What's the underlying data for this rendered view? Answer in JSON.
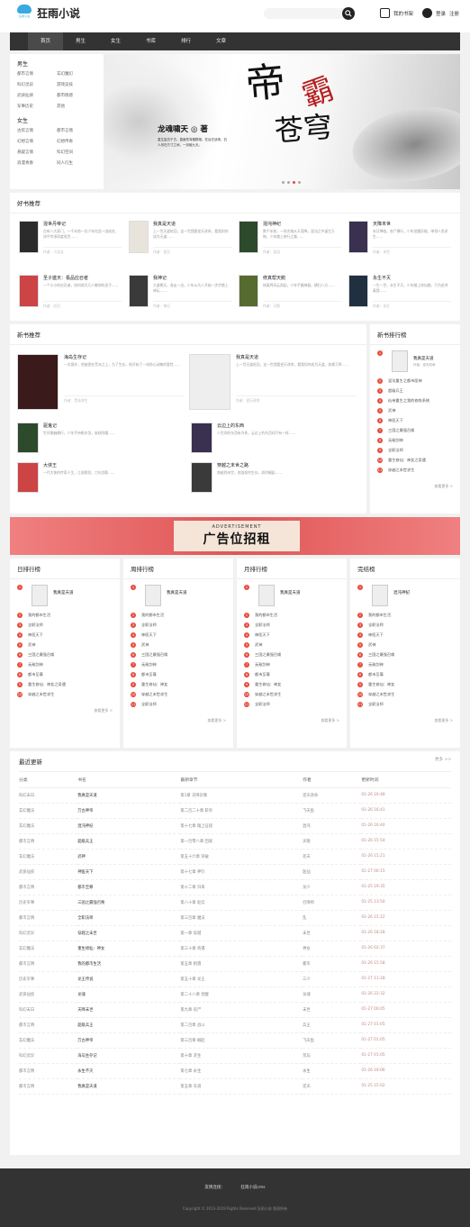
{
  "header": {
    "logo_text": "狂雨小说",
    "logo_tag": "狂雨小说",
    "search_placeholder": "",
    "my_shelf": "我的书架",
    "login": "登录",
    "register": "注册"
  },
  "nav": [
    "首页",
    "男生",
    "女生",
    "书库",
    "排行",
    "文章"
  ],
  "categories": {
    "male_title": "男生",
    "male": [
      "都市言情",
      "玄幻魔幻",
      "科幻灵异",
      "游戏竞技",
      "武侠仙侠",
      "都市情感",
      "军事历史",
      "其他"
    ],
    "female_title": "女生",
    "female": [
      "古装言情",
      "都市言情",
      "幻想言情",
      "幻想传奇",
      "悬疑言情",
      "科幻空间",
      "浪漫青春",
      "同人衍生"
    ]
  },
  "banner": {
    "author": "龙魂啸天 ◎ 著",
    "title_a": "帝",
    "title_b": "霸",
    "title_c": "苍穹",
    "desc": "重生复仇千古，直面苍穹傲群雄，在远古战场，仇人尽在方寸之间，一剑破九天。"
  },
  "good_books": {
    "title": "好书推荐",
    "items": [
      {
        "name": "混世丹帝记",
        "desc": "古有八大豪门，一千年前一位少年在此一战成名，如今传承再度现世……",
        "auth": "作者：小巫女"
      },
      {
        "name": "我真是天道",
        "desc": "上一世天道轮回，这一世我要逆天改命，看我如何成为天道……",
        "auth": "作者：逆天"
      },
      {
        "name": "混沌神纪",
        "desc": "数千年前，一场灾难从天而降，混沌之中诞生万物，少年踏上修行之路……",
        "auth": "作者：混沌"
      },
      {
        "name": "天降末世",
        "desc": "末日降临，丧尸横行，少年觉醒异能，带领人类求生……",
        "auth": "作者：末世"
      },
      {
        "name": "圣子盛天：极品应召者",
        "desc": "一个小小的应召者，如何成为万人敬仰的圣子……",
        "auth": "作者：应召"
      },
      {
        "name": "我神记",
        "desc": "大道朝天，各走一边，少年从凡人开始一步步踏上神坛……",
        "auth": "作者：神记"
      },
      {
        "name": "修真帮天鹅",
        "desc": "修真界风云再起，少年手握神器，横扫八方……",
        "auth": "作者：天鹅"
      },
      {
        "name": "永生不灭",
        "desc": "一生一世，永生不灭，少年踏上修仙路，只为追寻真我……",
        "auth": "作者：永生"
      }
    ]
  },
  "new_books": {
    "title": "新书推荐",
    "big": [
      {
        "name": "海岛生存记",
        "desc": "一次意外，他被困在荒岛之上，为了生存，他开始了一场惊心动魄的冒险……",
        "auth": "作者：荒岛求生"
      },
      {
        "name": "我真是天道",
        "desc": "上一世天道轮回，这一世我要逆天改命，看我如何成为天道，执掌万界……",
        "auth": "作者：逆天改命"
      }
    ],
    "small": [
      {
        "name": "驱鬼记",
        "desc": "世间鬼魅横行，少年手持桃木剑，斩妖除魔……"
      },
      {
        "name": "云边上的东西",
        "desc": "人世间的东西有许多，云边上的东西却只有一样……"
      },
      {
        "name": "大侠王",
        "desc": "一代大侠的传奇人生，江湖恩怨，刀光剑影……"
      },
      {
        "name": "穿越之末世之路",
        "desc": "穿越到末世，他该如何生存，如何崛起……"
      }
    ]
  },
  "new_rank": {
    "title": "新书排行榜",
    "first": {
      "name": "我真是天道",
      "auth": "作者：逆天改命"
    },
    "items": [
      "混沌重生之都市医神",
      "超级兵王",
      "仙帝重生之我的修炼系统",
      "武神",
      "神医天下",
      "三国之最强召唤",
      "无敌剑神",
      "全职法师",
      "重生修仙：神女之奇遇",
      "穿越之末世求生"
    ],
    "more": "查看更多 >"
  },
  "ad": {
    "en": "ADVERTISEMENT",
    "cn": "广告位招租"
  },
  "ranks": [
    {
      "title": "日排行榜",
      "first": "我真是天道",
      "items": [
        "我的都市生活",
        "全职法师",
        "神医天下",
        "武神",
        "三国之最强召唤",
        "无敌剑神",
        "都市至尊",
        "重生修仙：神女之奇遇",
        "穿越之末世求生"
      ],
      "more": "查看更多 >"
    },
    {
      "title": "周排行榜",
      "first": "我真是天道",
      "items": [
        "我的都市生活",
        "全职法师",
        "神医天下",
        "武神",
        "三国之最强召唤",
        "无敌剑神",
        "都市至尊",
        "重生修仙：神女",
        "穿越之末世求生",
        "全职法师"
      ],
      "more": "查看更多 >"
    },
    {
      "title": "月排行榜",
      "first": "我真是天道",
      "items": [
        "我的都市生活",
        "全职法师",
        "神医天下",
        "武神",
        "三国之最强召唤",
        "无敌剑神",
        "都市至尊",
        "重生修仙：神女",
        "穿越之末世求生",
        "全职法师"
      ],
      "more": "查看更多 >"
    },
    {
      "title": "完结榜",
      "first": "混沌神纪",
      "items": [
        "我的都市生活",
        "全职法师",
        "神医天下",
        "武神",
        "三国之最强召唤",
        "无敌剑神",
        "都市至尊",
        "重生修仙：神女",
        "穿越之末世求生",
        "全职法师"
      ],
      "more": "查看更多 >"
    }
  ],
  "latest": {
    "title": "最近更新",
    "more": "更多 >>",
    "cols": [
      "分类",
      "书名",
      "最新章节",
      "作者",
      "更新时间"
    ],
    "rows": [
      [
        "科幻末日",
        "我真是天道",
        "第1章 天降异象",
        "逆天改命",
        "01-26 16:48"
      ],
      [
        "玄幻魔法",
        "万古神帝",
        "第二百二十章 斩杀",
        "飞天鱼",
        "01-26 16:41"
      ],
      [
        "玄幻魔法",
        "混沌神纪",
        "第十七章 踏上征程",
        "混沌",
        "01-26 16:40"
      ],
      [
        "都市言情",
        "超级兵王",
        "第一百零八章 回家",
        "天狼",
        "01-26 15:54"
      ],
      [
        "玄幻魔法",
        "武神",
        "第五十六章 突破",
        "苍天",
        "01-26 15:21"
      ],
      [
        "武侠仙侠",
        "神医天下",
        "第十七章 神针",
        "医仙",
        "01-27 00:15"
      ],
      [
        "都市言情",
        "都市至尊",
        "第十二章 归来",
        "龙少",
        "01-25 19:35"
      ],
      [
        "历史军事",
        "三国之最强召唤",
        "第八十章 赵云",
        "召唤师",
        "01-25 13:50"
      ],
      [
        "都市言情",
        "全职法师",
        "第三百章 魔法",
        "乱",
        "01-26 15:22"
      ],
      [
        "科幻灵异",
        "穿越之末世",
        "第一章 穿越",
        "末世",
        "01-26 18:28"
      ],
      [
        "玄幻魔法",
        "重生修仙：神女",
        "第三十章 奇遇",
        "神女",
        "01-26 02:37"
      ],
      [
        "都市言情",
        "我的都市生活",
        "第五章 相遇",
        "都市",
        "01-26 15:58"
      ],
      [
        "历史军事",
        "龙王传说",
        "第五十章 龙王",
        "三少",
        "01-27 11:28"
      ],
      [
        "武侠仙侠",
        "龙魂",
        "第二十八章 觉醒",
        "龙魂",
        "01-26 22:32"
      ],
      [
        "科幻末日",
        "天降末世",
        "第九章 丧尸",
        "末世",
        "01-27 00:05"
      ],
      [
        "都市言情",
        "超级兵王",
        "第二百章 战斗",
        "兵王",
        "01-27 01:05"
      ],
      [
        "玄幻魔法",
        "万古神帝",
        "第三百章 崛起",
        "飞天鱼",
        "01-27 01:05"
      ],
      [
        "科幻灵异",
        "海岛生存记",
        "第十章 求生",
        "荒岛",
        "01-27 01:05"
      ],
      [
        "都市言情",
        "永生不灭",
        "第七章 永生",
        "永生",
        "01-26 19:06"
      ],
      [
        "都市言情",
        "我真是天道",
        "第五章 天道",
        "逆天",
        "01-25 15:02"
      ]
    ]
  },
  "footer": {
    "links": [
      "友情连接：",
      "狂雨小说cms"
    ],
    "copy": "Copyright © 2013-2019 Rights Reserved 狂雨小说 版权所有"
  },
  "colors": {
    "accent": "#e74c3c",
    "nav_bg": "#333333",
    "logo": "#39a9e0"
  }
}
